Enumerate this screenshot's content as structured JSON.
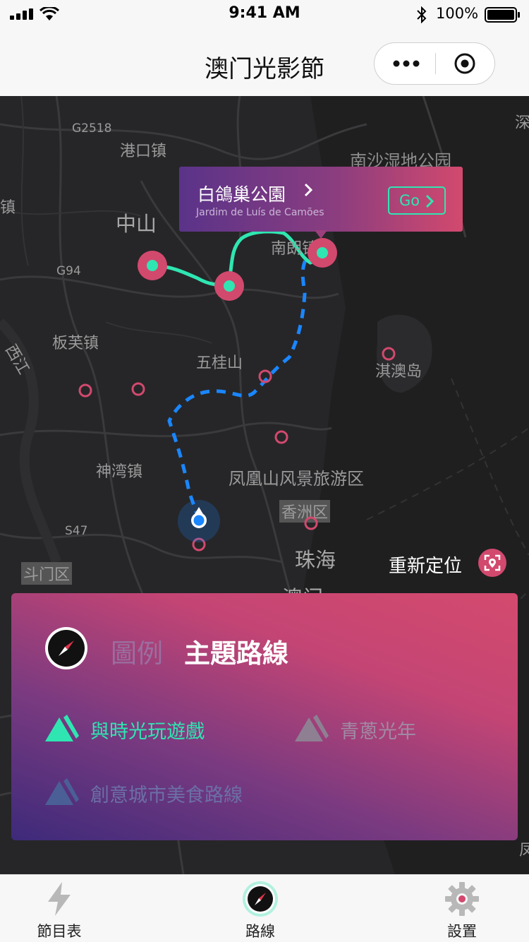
{
  "status_bar": {
    "time": "9:41 AM",
    "battery": "100%"
  },
  "nav": {
    "title": "澳门光影節"
  },
  "map": {
    "labels": [
      {
        "text": "G2518"
      },
      {
        "text": "港口镇"
      },
      {
        "text": "南沙湿地公园"
      },
      {
        "text": "深"
      },
      {
        "text": "中山"
      },
      {
        "text": "G94"
      },
      {
        "text": "南朗镇"
      },
      {
        "text": "板芙镇"
      },
      {
        "text": "西江"
      },
      {
        "text": "五桂山"
      },
      {
        "text": "淇澳岛"
      },
      {
        "text": "神湾镇"
      },
      {
        "text": "凤凰山风景旅游区"
      },
      {
        "text": "S47"
      },
      {
        "text": "香洲区"
      },
      {
        "text": "珠海"
      },
      {
        "text": "斗门区"
      },
      {
        "text": "澳门"
      },
      {
        "text": "镇"
      },
      {
        "text": "凤"
      }
    ],
    "relocate_label": "重新定位"
  },
  "popup": {
    "name": "白鴿巢公園",
    "subtitle": "Jardim de Luís de Camões",
    "go_label": "Go"
  },
  "legend": {
    "tab_inactive": "圖例",
    "tab_active": "主題路線",
    "routes": [
      {
        "label": "與時光玩遊戲",
        "color": "#2fe6b2",
        "active": true
      },
      {
        "label": "青蔥光年",
        "color": "#9a8a9c",
        "active": false
      },
      {
        "label": "創意城市美食路線",
        "color": "#5c6fa8",
        "active": false
      }
    ]
  },
  "tabs": [
    {
      "label": "節目表",
      "icon": "lightning-icon"
    },
    {
      "label": "路線",
      "icon": "compass-icon",
      "active": true
    },
    {
      "label": "設置",
      "icon": "gear-icon"
    }
  ],
  "colors": {
    "accent_pink": "#d2496e",
    "accent_teal": "#2fe6b2",
    "route_blue": "#1a86ff"
  }
}
